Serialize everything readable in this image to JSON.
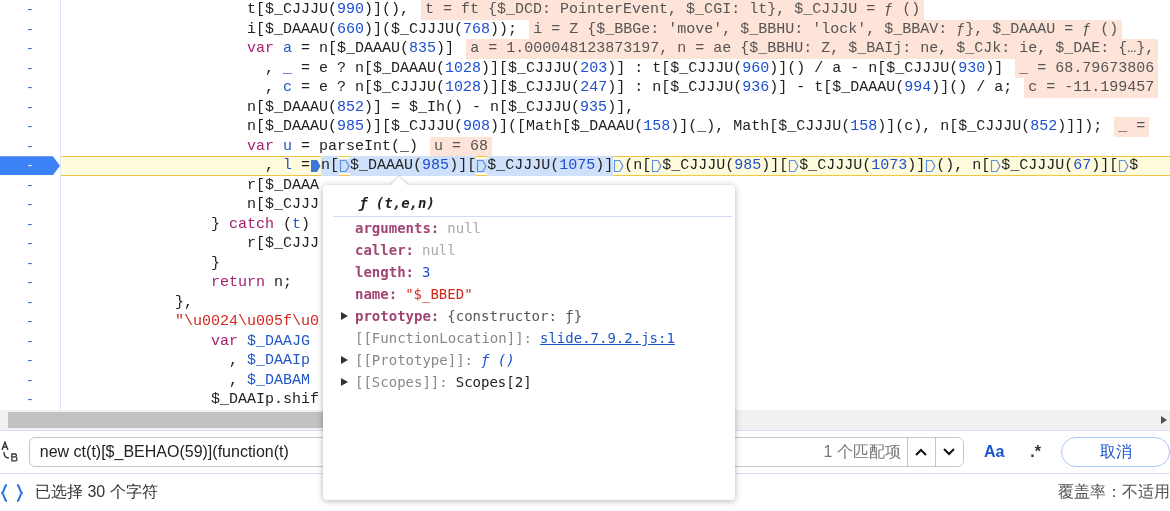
{
  "editor": {
    "lines": [
      {
        "gutter": "-",
        "current": false,
        "segments": [
          {
            "t": "                    t[$_CJJJU(",
            "kind": "p"
          },
          {
            "t": "990",
            "kind": "num"
          },
          {
            "t": ")](),",
            "kind": "p"
          }
        ],
        "annotation": "t = ft {$_DCD: PointerEvent, $_CGI: lt}, $_CJJJU = ƒ ()"
      },
      {
        "gutter": "-",
        "current": false,
        "segments": [
          {
            "t": "                    i[$_DAAAU(",
            "kind": "p"
          },
          {
            "t": "660",
            "kind": "num"
          },
          {
            "t": ")]($_CJJJU(",
            "kind": "p"
          },
          {
            "t": "768",
            "kind": "num"
          },
          {
            "t": "));",
            "kind": "p"
          }
        ],
        "annotation": "i = Z {$_BBGe: 'move', $_BBHU: 'lock', $_BBAV: ƒ}, $_DAAAU = ƒ ()"
      },
      {
        "gutter": "-",
        "current": false,
        "segments": [
          {
            "t": "                    var",
            "kind": "kw"
          },
          {
            "t": " a",
            "kind": "var"
          },
          {
            "t": " = n[$_DAAAU(",
            "kind": "p"
          },
          {
            "t": "835",
            "kind": "num"
          },
          {
            "t": ")]",
            "kind": "p"
          }
        ],
        "annotation": "a = 1.000048123873197, n = ae {$_BBHU: Z, $_BAIj: ne, $_CJk: ie, $_DAE: {…},"
      },
      {
        "gutter": "-",
        "current": false,
        "segments": [
          {
            "t": "                      ,",
            "kind": "p"
          },
          {
            "t": " _",
            "kind": "var"
          },
          {
            "t": " = e ? n[$_DAAAU(",
            "kind": "p"
          },
          {
            "t": "1028",
            "kind": "num"
          },
          {
            "t": ")][$_CJJJU(",
            "kind": "p"
          },
          {
            "t": "203",
            "kind": "num"
          },
          {
            "t": ")] : t[$_CJJJU(",
            "kind": "p"
          },
          {
            "t": "960",
            "kind": "num"
          },
          {
            "t": ")]() / a - n[$_CJJJU(",
            "kind": "p"
          },
          {
            "t": "930",
            "kind": "num"
          },
          {
            "t": ")]",
            "kind": "p"
          }
        ],
        "annotation": "_ = 68.79673806"
      },
      {
        "gutter": "-",
        "current": false,
        "segments": [
          {
            "t": "                      ,",
            "kind": "p"
          },
          {
            "t": " c",
            "kind": "var"
          },
          {
            "t": " = e ? n[$_CJJJU(",
            "kind": "p"
          },
          {
            "t": "1028",
            "kind": "num"
          },
          {
            "t": ")][$_CJJJU(",
            "kind": "p"
          },
          {
            "t": "247",
            "kind": "num"
          },
          {
            "t": ")] : n[$_CJJJU(",
            "kind": "p"
          },
          {
            "t": "936",
            "kind": "num"
          },
          {
            "t": ")] - t[$_DAAAU(",
            "kind": "p"
          },
          {
            "t": "994",
            "kind": "num"
          },
          {
            "t": ")]() / a;",
            "kind": "p"
          }
        ],
        "annotation": "c = -11.199457"
      },
      {
        "gutter": "-",
        "current": false,
        "segments": [
          {
            "t": "                    n[$_DAAAU(",
            "kind": "p"
          },
          {
            "t": "852",
            "kind": "num"
          },
          {
            "t": ")] = $_Ih() - n[$_CJJJU(",
            "kind": "p"
          },
          {
            "t": "935",
            "kind": "num"
          },
          {
            "t": ")],",
            "kind": "p"
          }
        ]
      },
      {
        "gutter": "-",
        "current": false,
        "segments": [
          {
            "t": "                    n[$_DAAAU(",
            "kind": "p"
          },
          {
            "t": "985",
            "kind": "num"
          },
          {
            "t": ")][$_CJJJU(",
            "kind": "p"
          },
          {
            "t": "908",
            "kind": "num"
          },
          {
            "t": ")]([Math[$_DAAAU(",
            "kind": "p"
          },
          {
            "t": "158",
            "kind": "num"
          },
          {
            "t": ")](_), Math[$_CJJJU(",
            "kind": "p"
          },
          {
            "t": "158",
            "kind": "num"
          },
          {
            "t": ")](c), n[$_CJJJU(",
            "kind": "p"
          },
          {
            "t": "852",
            "kind": "num"
          },
          {
            "t": ")]]);",
            "kind": "p"
          }
        ],
        "annotation": "_ ="
      },
      {
        "gutter": "-",
        "current": false,
        "segments": [
          {
            "t": "                    var",
            "kind": "kw"
          },
          {
            "t": " u",
            "kind": "var"
          },
          {
            "t": " = parseInt(_)",
            "kind": "p"
          }
        ],
        "annotation": "u = 68"
      },
      {
        "gutter": "-",
        "current": true,
        "segments": [
          {
            "t": "                      ,",
            "kind": "p",
            "selected": false
          },
          {
            "t": " l",
            "kind": "var",
            "selected": false
          },
          {
            "t": " =",
            "kind": "p",
            "selected": false
          },
          {
            "kind": "marker",
            "active": true,
            "selected": false
          },
          {
            "t": "n[",
            "kind": "p",
            "selected": true
          },
          {
            "kind": "marker",
            "active": false,
            "selected": true
          },
          {
            "t": "$_DAAAU(",
            "kind": "p",
            "selected": true
          },
          {
            "t": "985",
            "kind": "num",
            "selected": true
          },
          {
            "t": ")][",
            "kind": "p",
            "selected": true
          },
          {
            "kind": "marker",
            "active": false,
            "selected": true
          },
          {
            "t": "$_CJJJU(",
            "kind": "p",
            "selected": true
          },
          {
            "t": "1075",
            "kind": "num",
            "selected": true
          },
          {
            "t": ")]",
            "kind": "p",
            "selected": true
          },
          {
            "kind": "marker",
            "active": false,
            "selected": false
          },
          {
            "t": "(n[",
            "kind": "p",
            "selected": false
          },
          {
            "kind": "marker",
            "active": false,
            "selected": false
          },
          {
            "t": "$_CJJJU(",
            "kind": "p",
            "selected": false
          },
          {
            "t": "985",
            "kind": "num",
            "selected": false
          },
          {
            "t": ")][",
            "kind": "p",
            "selected": false
          },
          {
            "kind": "marker",
            "active": false,
            "selected": false
          },
          {
            "t": "$_CJJJU(",
            "kind": "p",
            "selected": false
          },
          {
            "t": "1073",
            "kind": "num",
            "selected": false
          },
          {
            "t": ")]",
            "kind": "p",
            "selected": false
          },
          {
            "kind": "marker",
            "active": false,
            "selected": false
          },
          {
            "t": "(), n[",
            "kind": "p",
            "selected": false
          },
          {
            "kind": "marker",
            "active": false,
            "selected": false
          },
          {
            "t": "$_CJJJU(",
            "kind": "p",
            "selected": false
          },
          {
            "t": "67",
            "kind": "num",
            "selected": false
          },
          {
            "t": ")][",
            "kind": "p",
            "selected": false
          },
          {
            "kind": "marker",
            "active": false,
            "selected": false
          },
          {
            "t": "$",
            "kind": "p",
            "selected": false
          }
        ]
      },
      {
        "gutter": "-",
        "current": false,
        "segments": [
          {
            "t": "                    r[$_DAAA",
            "kind": "p"
          }
        ]
      },
      {
        "gutter": "-",
        "current": false,
        "segments": [
          {
            "t": "                    n[$_CJJJ",
            "kind": "p"
          }
        ]
      },
      {
        "gutter": "-",
        "current": false,
        "segments": [
          {
            "t": "                }",
            "kind": "p"
          },
          {
            "t": " catch",
            "kind": "kw"
          },
          {
            "t": " (",
            "kind": "p"
          },
          {
            "t": "t",
            "kind": "var"
          },
          {
            "t": ")",
            "kind": "p"
          }
        ]
      },
      {
        "gutter": "-",
        "current": false,
        "segments": [
          {
            "t": "                    r[$_CJJJ",
            "kind": "p"
          }
        ]
      },
      {
        "gutter": "-",
        "current": false,
        "segments": [
          {
            "t": "                }",
            "kind": "p"
          }
        ]
      },
      {
        "gutter": "-",
        "current": false,
        "segments": [
          {
            "t": "                return",
            "kind": "kw"
          },
          {
            "t": " n;",
            "kind": "p"
          }
        ]
      },
      {
        "gutter": "-",
        "current": false,
        "segments": [
          {
            "t": "            },",
            "kind": "p"
          }
        ]
      },
      {
        "gutter": "-",
        "current": false,
        "segments": [
          {
            "t": "            \"\\u0024\\u005f\\u0",
            "kind": "str"
          }
        ]
      },
      {
        "gutter": "-",
        "current": false,
        "segments": [
          {
            "t": "                var",
            "kind": "kw"
          },
          {
            "t": " $_DAAJG",
            "kind": "var"
          }
        ]
      },
      {
        "gutter": "-",
        "current": false,
        "segments": [
          {
            "t": "                  ,",
            "kind": "p"
          },
          {
            "t": " $_DAAIp",
            "kind": "var"
          }
        ]
      },
      {
        "gutter": "-",
        "current": false,
        "segments": [
          {
            "t": "                  ,",
            "kind": "p"
          },
          {
            "t": " $_DABAM",
            "kind": "var"
          }
        ]
      },
      {
        "gutter": "-",
        "current": false,
        "segments": [
          {
            "t": "                $_DAAIp.shif",
            "kind": "p"
          }
        ]
      }
    ]
  },
  "popup": {
    "title": "ƒ (t,e,n)",
    "properties": [
      {
        "key": "arguments:",
        "value": "null",
        "kind": "null",
        "internal": false,
        "expandable": false
      },
      {
        "key": "caller:",
        "value": "null",
        "kind": "null",
        "internal": false,
        "expandable": false
      },
      {
        "key": "length:",
        "value": "3",
        "kind": "num",
        "internal": false,
        "expandable": false
      },
      {
        "key": "name:",
        "value": "\"$_BBED\"",
        "kind": "str",
        "internal": false,
        "expandable": false
      },
      {
        "key": "prototype:",
        "value": "{constructor: ƒ}",
        "kind": "obj",
        "internal": false,
        "expandable": true
      },
      {
        "key": "[[FunctionLocation]]:",
        "value": "slide.7.9.2.js:1",
        "kind": "link",
        "internal": true,
        "expandable": false
      },
      {
        "key": "[[Prototype]]:",
        "value": "ƒ ()",
        "kind": "fn",
        "internal": true,
        "expandable": true
      },
      {
        "key": "[[Scopes]]:",
        "value": "Scopes[2]",
        "kind": "plain",
        "internal": true,
        "expandable": true
      }
    ]
  },
  "search": {
    "value": "new ct(t)[$_BEHAO(59)](function(t)",
    "match_count": "1 个匹配项",
    "case_label": "Aa",
    "regex_label": ".*",
    "cancel": "取消"
  },
  "status_bar": {
    "selection": "已选择 30 个字符",
    "coverage": "覆盖率：不适用"
  }
}
